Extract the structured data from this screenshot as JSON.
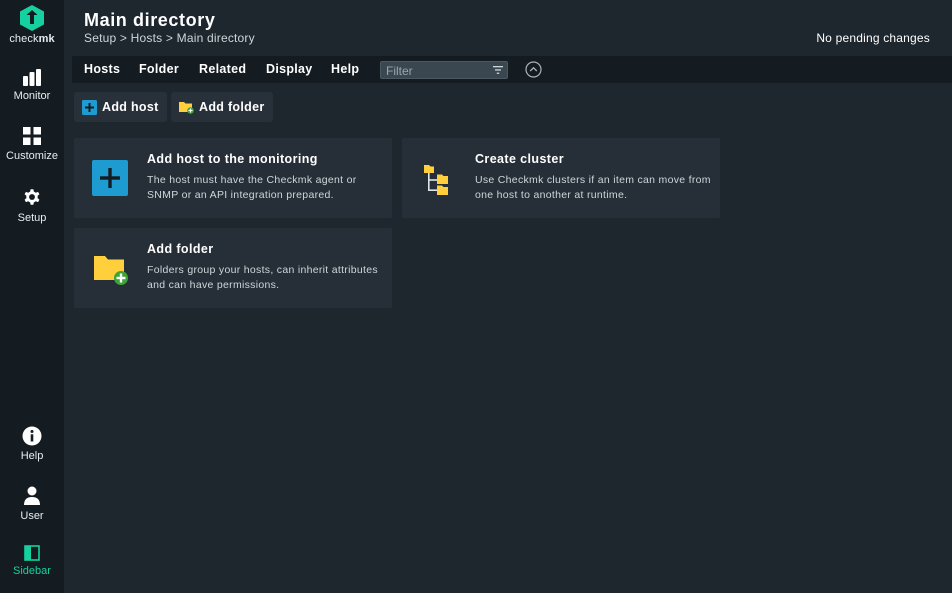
{
  "nav": {
    "logo_text_regular": "check",
    "logo_text_bold": "mk",
    "items": [
      {
        "label": "Monitor",
        "icon": "monitor-icon"
      },
      {
        "label": "Customize",
        "icon": "customize-icon"
      },
      {
        "label": "Setup",
        "icon": "setup-gear-icon"
      },
      {
        "label": "Help",
        "icon": "help-icon"
      },
      {
        "label": "User",
        "icon": "user-icon"
      },
      {
        "label": "Sidebar",
        "icon": "sidebar-icon"
      }
    ]
  },
  "header": {
    "title": "Main directory",
    "breadcrumb": [
      "Setup",
      ">",
      "Hosts",
      ">",
      "Main directory"
    ],
    "pending_changes": "No pending changes"
  },
  "menubar": {
    "items": [
      "Hosts",
      "Folder",
      "Related",
      "Display",
      "Help"
    ],
    "filter_placeholder": "Filter"
  },
  "buttons": {
    "add_host": "Add host",
    "add_folder": "Add folder"
  },
  "cards": [
    {
      "title": "Add host to the monitoring",
      "description": "The host must have the Checkmk agent or SNMP or an API integration prepared.",
      "icon": "add-host-icon"
    },
    {
      "title": "Create cluster",
      "description": "Use Checkmk clusters if an item can move from one host to another at runtime.",
      "icon": "cluster-icon"
    },
    {
      "title": "Add folder",
      "description": "Folders group your hosts, can inherit attributes and can have permissions.",
      "icon": "add-folder-icon"
    }
  ],
  "colors": {
    "brand": "#15d1a0",
    "background": "#1e262e",
    "nav_background": "#141b21",
    "card_background": "#262f37",
    "add_host_blue": "#1e9bd1",
    "folder_yellow": "#ffd03b",
    "folder_add_green": "#3fa338"
  }
}
